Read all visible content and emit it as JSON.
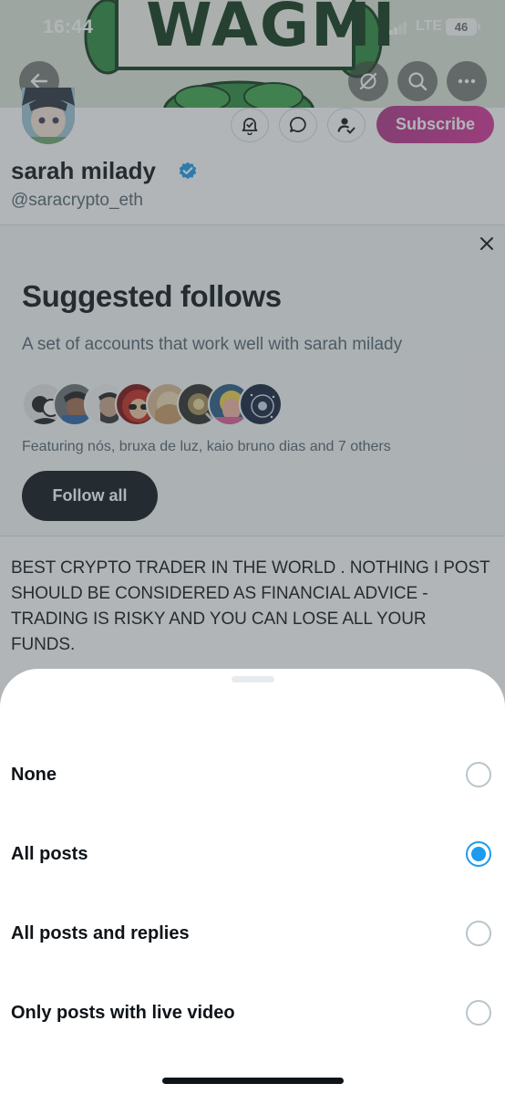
{
  "status_bar": {
    "time": "16:44",
    "network": "LTE",
    "battery": "46"
  },
  "banner": {
    "text": "WAGMI",
    "colors": {
      "background": "#dde6d8",
      "frog": "#2e8b3e",
      "dark_frog": "#1f6b2c"
    }
  },
  "header": {
    "back_icon": "arrow-left-icon",
    "grok_icon": "grok-icon",
    "search_icon": "search-icon",
    "more_icon": "more-horizontal-icon"
  },
  "profile": {
    "display_name": "sarah milady",
    "handle": "@saracrypto_eth",
    "verified": true,
    "actions": [
      "bell-check-icon",
      "message-icon",
      "person-check-icon"
    ],
    "subscribe_label": "Subscribe",
    "bio": "BEST CRYPTO TRADER IN THE WORLD . NOTHING I POST SHOULD BE CONSIDERED AS FINANCIAL ADVICE - TRADING IS RISKY AND YOU CAN LOSE ALL YOUR FUNDS."
  },
  "suggested_follows": {
    "title": "Suggested follows",
    "subtitle": "A set of accounts that work well with sarah milady",
    "featuring": "Featuring nós, bruxa de luz, kaio bruno dias and 7 others",
    "follow_all_label": "Follow all",
    "close_icon": "close-icon"
  },
  "notification_sheet": {
    "options": [
      {
        "label": "None",
        "selected": false
      },
      {
        "label": "All posts",
        "selected": true
      },
      {
        "label": "All posts and replies",
        "selected": false
      },
      {
        "label": "Only posts with live video",
        "selected": false
      }
    ],
    "accent_color": "#1d9bf0"
  }
}
